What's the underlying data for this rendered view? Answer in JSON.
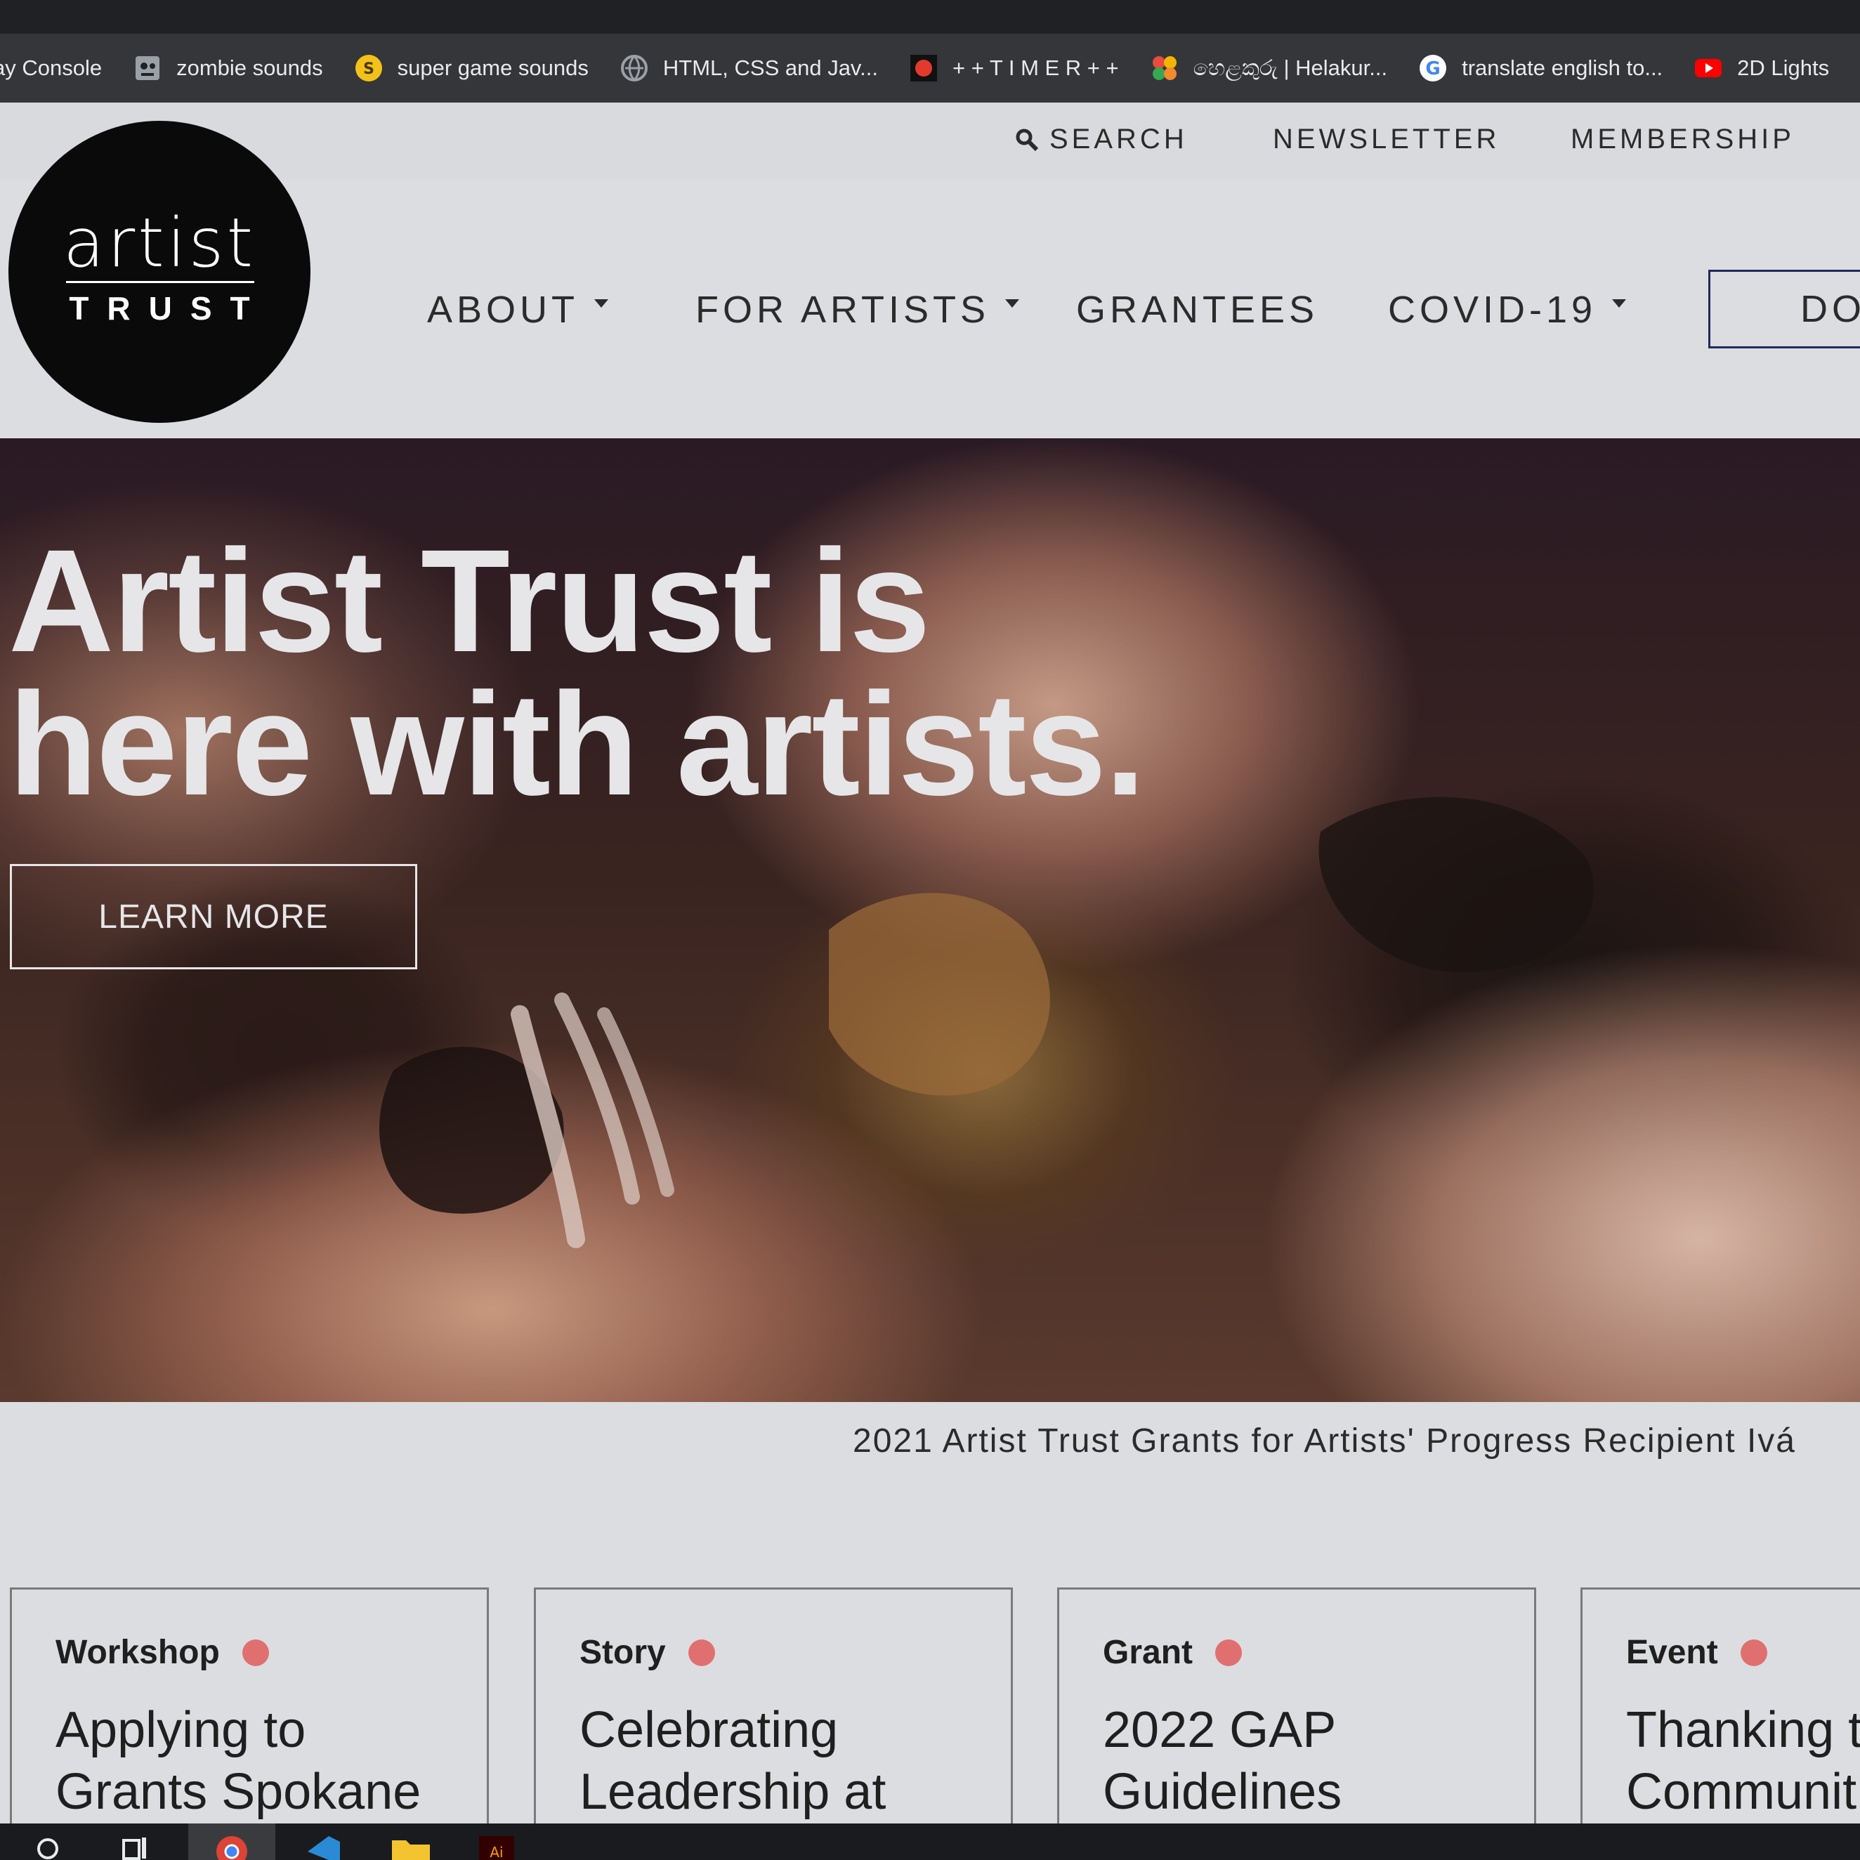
{
  "bookmarks": [
    {
      "label": "ay Console",
      "icon": "console-icon"
    },
    {
      "label": "zombie sounds",
      "icon": "zombie-icon"
    },
    {
      "label": "super game sounds",
      "icon": "coin-icon"
    },
    {
      "label": "HTML, CSS and Jav...",
      "icon": "globe-icon"
    },
    {
      "label": "+ + T I M E R + +",
      "icon": "timer-icon"
    },
    {
      "label": "හෙළකුරු | Helakur...",
      "icon": "flower-icon"
    },
    {
      "label": "translate english to...",
      "icon": "google-icon"
    },
    {
      "label": "2D Lights",
      "icon": "youtube-icon"
    }
  ],
  "utility": {
    "search": "SEARCH",
    "newsletter": "NEWSLETTER",
    "membership": "MEMBERSHIP"
  },
  "logo": {
    "top": "artist",
    "bottom": "TRUST"
  },
  "nav": {
    "about": "ABOUT",
    "for_artists": "FOR ARTISTS",
    "grantees": "GRANTEES",
    "covid": "COVID-19",
    "donate": "DO"
  },
  "hero": {
    "title_line1": "Artist Trust is",
    "title_line2": "here with artists.",
    "button": "LEARN MORE"
  },
  "caption": "2021 Artist Trust Grants for Artists' Progress Recipient Ivá",
  "cards": [
    {
      "type": "Workshop",
      "title1": "Applying to",
      "title2": "Grants Spokane"
    },
    {
      "type": "Story",
      "title1": "Celebrating",
      "title2": "Leadership at"
    },
    {
      "type": "Grant",
      "title1": "2022 GAP",
      "title2": "Guidelines"
    },
    {
      "type": "Event",
      "title1": "Thanking t",
      "title2": "Communit"
    }
  ],
  "colors": {
    "accent_dot": "#e07070",
    "donate_border": "#1f2a5a",
    "page_bg": "#dcdde0"
  }
}
